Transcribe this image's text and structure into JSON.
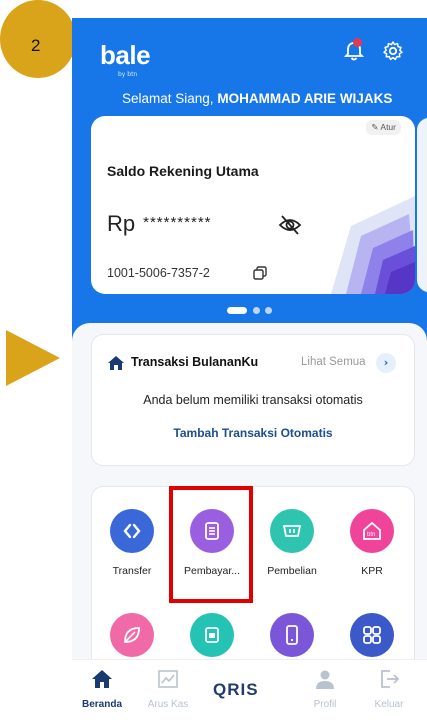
{
  "step": {
    "number": "2",
    "color": "#d9a41a"
  },
  "header": {
    "logo": "bale",
    "logo_sub": "by btn",
    "greeting_prefix": "Selamat Siang,",
    "user_name": "MOHAMMAD ARIE WIJAKS"
  },
  "card": {
    "edit_label": "Atur",
    "title": "Saldo Rekening Utama",
    "currency": "Rp",
    "balance_masked": "**********",
    "account_number": "1001-5006-7357-2",
    "carousel_pages": 3,
    "carousel_active": 1
  },
  "transactions": {
    "title": "Transaksi BulananKu",
    "see_all": "Lihat Semua",
    "empty_message": "Anda belum memiliki transaksi otomatis",
    "add_link": "Tambah Transaksi Otomatis"
  },
  "menu": {
    "items": [
      {
        "label": "Transfer",
        "icon": "transfer-icon",
        "color": "#3a68d8"
      },
      {
        "label": "Pembayar...",
        "icon": "bill-icon",
        "color": "#9a5fe0"
      },
      {
        "label": "Pembelian",
        "icon": "shopping-icon",
        "color": "#2ec4b0"
      },
      {
        "label": "KPR",
        "icon": "kpr-icon",
        "color": "#f0439a"
      },
      {
        "label": "",
        "icon": "leaf-icon",
        "color": "#f06aa8"
      },
      {
        "label": "",
        "icon": "cup-icon",
        "color": "#25c3b3"
      },
      {
        "label": "",
        "icon": "phone-icon",
        "color": "#7b56d9"
      },
      {
        "label": "",
        "icon": "grid-icon",
        "color": "#3b59c9"
      }
    ]
  },
  "nav": {
    "items": [
      {
        "label": "Beranda",
        "icon": "home-icon",
        "active": true
      },
      {
        "label": "Arus Kas",
        "icon": "chart-icon",
        "active": false
      },
      {
        "label": "QRIS",
        "icon": "qris-icon",
        "active": false
      },
      {
        "label": "Profil",
        "icon": "profile-icon",
        "active": false
      },
      {
        "label": "Keluar",
        "icon": "logout-icon",
        "active": false
      }
    ]
  }
}
